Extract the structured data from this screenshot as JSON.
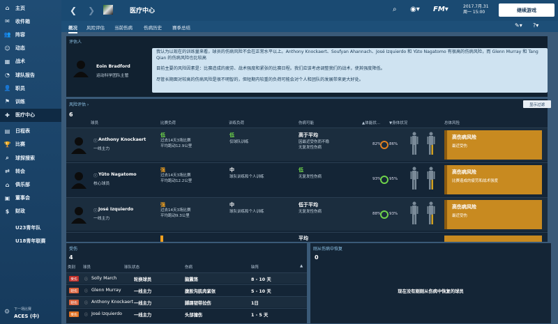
{
  "sidebar": {
    "items": [
      {
        "label": "主页",
        "icon": "home-icon",
        "glyph": "⌂"
      },
      {
        "label": "收件箱",
        "icon": "inbox-icon",
        "glyph": "✉"
      },
      {
        "label": "阵容",
        "icon": "squad-icon",
        "glyph": "👥"
      },
      {
        "label": "动态",
        "icon": "dynamics-icon",
        "glyph": "☺"
      },
      {
        "label": "战术",
        "icon": "tactics-icon",
        "glyph": "▦"
      },
      {
        "label": "球队报告",
        "icon": "report-icon",
        "glyph": "◔"
      },
      {
        "label": "职员",
        "icon": "staff-icon",
        "glyph": "👤"
      },
      {
        "label": "训练",
        "icon": "training-icon",
        "glyph": "⚑"
      },
      {
        "label": "医疗中心",
        "icon": "medical-icon",
        "glyph": "✚",
        "active": true
      },
      {
        "label": "日程表",
        "icon": "calendar-icon",
        "glyph": "▤"
      },
      {
        "label": "比赛",
        "icon": "competition-icon",
        "glyph": "🏆"
      },
      {
        "label": "球探搜索",
        "icon": "scouting-icon",
        "glyph": "⌕"
      },
      {
        "label": "转会",
        "icon": "transfers-icon",
        "glyph": "⇄"
      },
      {
        "label": "俱乐部",
        "icon": "club-icon",
        "glyph": "⌂"
      },
      {
        "label": "董事会",
        "icon": "board-icon",
        "glyph": "▣"
      },
      {
        "label": "财政",
        "icon": "finance-icon",
        "glyph": "$"
      },
      {
        "label": "U23青年队",
        "icon": "u23-icon",
        "glyph": ""
      },
      {
        "label": "U18青年联赛",
        "icon": "u18-icon",
        "glyph": ""
      }
    ],
    "next_opponent_label": "下一场比赛",
    "next_opponent": "ACES (中)"
  },
  "topbar": {
    "title": "医疗中心",
    "date_line1": "2017.7月.31",
    "date_line2": "周一 15:00",
    "continue_label": "继续游戏",
    "brand": "FM"
  },
  "tabs": [
    "概况",
    "风险评估",
    "当前伤病",
    "伤病历史",
    "赛季总结"
  ],
  "assessor": {
    "header": "评估人",
    "name": "Eoin Bradford",
    "role": "运动科学团队主管",
    "quote_p1": "我认为以现在的训练量来看，球员的伤病风险不会在正常水平以上。Anthony Knockaert、Soufyan Ahannach、José Izquierdo 和 Yûto Nagatomo 有很高的伤病风险，而 Glenn Murray 和 Tang Qian 的伤病风险也比较高",
    "quote_p2": "目前主要的风险因素是：比赛造成的疲劳、战术强度和紧张的比赛日程。我们应该考虑调整我们的战术，使其强度降低。",
    "quote_p3": "尽管长期面对较高的伤病风险是很不明智的，但短期内较重的负荷可能会对个人和团队的发展带来更大好处。"
  },
  "risk": {
    "header": "风险评估 ›",
    "count": "6",
    "show_filter": "显示过滤",
    "columns": [
      "球员",
      "比赛负荷",
      "训练负荷",
      "伤病可能",
      "▲体能状...",
      "▼身体状况",
      "总体风险"
    ],
    "players": [
      {
        "name": "Anthony Knockaert",
        "role": "一线主力",
        "match_load": "低",
        "match_sub1": "过去14天3场比赛",
        "match_sub2": "平均跑动12.9公里",
        "train_load": "低",
        "train_sub": "仅球队训练",
        "injury": "高于平均",
        "injury_sub1": "因最近受伤而不稳",
        "injury_sub2": "无复发性伤病",
        "cond1": "82%",
        "cond2": "86%",
        "risk": "高伤病风险",
        "risk_sub": "最近受伤"
      },
      {
        "name": "Yûto Nagatomo",
        "role": "核心球员",
        "match_load": "强",
        "match_sub1": "过去14天3场比赛",
        "match_sub2": "平均跑动12.2公里",
        "train_load": "中",
        "train_sub": "球队训练和个人训练",
        "injury": "低",
        "injury_sub1": "无复发性伤病",
        "injury_sub2": "",
        "cond1": "93%",
        "cond2": "95%",
        "risk": "高伤病风险",
        "risk_sub": "比赛造成的疲劳和战术强度"
      },
      {
        "name": "José Izquierdo",
        "role": "一线主力",
        "match_load": "强",
        "match_sub1": "过去14天3场比赛",
        "match_sub2": "平均跑动9.3公里",
        "train_load": "中",
        "train_sub": "球队训练和个人训练",
        "injury": "低于平均",
        "injury_sub1": "无复发性伤病",
        "injury_sub2": "",
        "cond1": "88%",
        "cond2": "93%",
        "risk": "高伤病风险",
        "risk_sub": "最近受伤"
      },
      {
        "name": "",
        "role": "",
        "match_load": "",
        "match_sub1": "",
        "match_sub2": "",
        "train_load": "",
        "train_sub": "",
        "injury": "平均",
        "injury_sub1": "",
        "injury_sub2": "",
        "cond1": "",
        "cond2": "",
        "risk": "",
        "risk_sub": ""
      }
    ]
  },
  "injuries": {
    "header": "受伤",
    "count": "4",
    "columns": [
      "类别",
      "球员",
      "球队状态",
      "伤病",
      "缺阵"
    ],
    "rows": [
      {
        "badge": "受伤",
        "badge_color": "#c0302a",
        "name": "Solly March",
        "status": "轮换球员",
        "injury": "脑震荡",
        "out": "8 - 10 天"
      },
      {
        "badge": "轻伤",
        "badge_color": "#d8603a",
        "name": "Glenn Murray",
        "status": "一线主力",
        "injury": "腹股沟肌肉紧张",
        "out": "5 - 10 天"
      },
      {
        "badge": "轻伤",
        "badge_color": "#d8603a",
        "name": "Anthony Knockaert",
        "status": "一线主力",
        "injury": "脚踝韧带拉伤",
        "out": "1日"
      },
      {
        "badge": "受伤",
        "badge_color": "#e07020",
        "name": "José Izquierdo",
        "status": "一线主力",
        "injury": "头部撞伤",
        "out": "1 - 5 天"
      }
    ]
  },
  "recovery": {
    "header": "刚从伤病中恢复",
    "count": "0",
    "empty": "现在没有刚刚从伤病中恢复的球员"
  },
  "colors": {
    "accent": "#1a4a72",
    "risk_high": "#c88a20",
    "low": "#6fd34a",
    "strong": "#f0a020"
  }
}
